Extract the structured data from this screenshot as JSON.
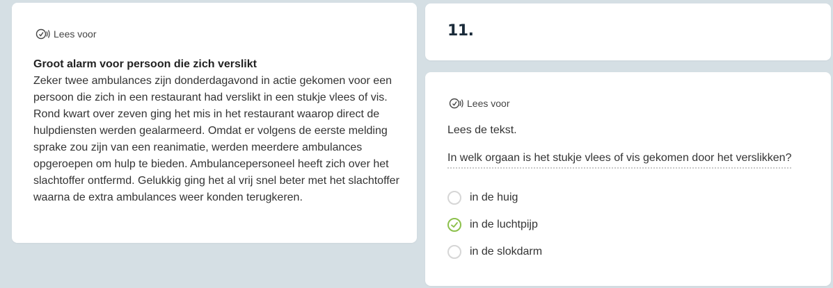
{
  "read_aloud_label": "Lees voor",
  "article": {
    "title": "Groot alarm voor persoon die zich verslikt",
    "body": "Zeker twee ambulances zijn donderdagavond in actie gekomen voor een persoon die zich in een restaurant had verslikt in een stukje vlees of vis. Rond kwart over zeven ging het mis in het restaurant waarop direct de hulpdiensten werden gealarmeerd. Omdat er volgens de eerste melding sprake zou zijn van een reanimatie, werden meerdere ambulances opgeroepen om hulp te bieden. Ambulancepersoneel heeft zich over het slachtoffer ontfermd. Gelukkig ging het al vrij snel beter met het slachtoffer waarna de extra ambulances weer konden terugkeren."
  },
  "question_number": "11.",
  "instruction": "Lees de tekst.",
  "question": "In welk orgaan is het stukje vlees of vis gekomen door het verslikken?",
  "options": [
    {
      "label": "in de huig",
      "selected": false
    },
    {
      "label": "in de luchtpijp",
      "selected": true
    },
    {
      "label": "in de slokdarm",
      "selected": false
    }
  ],
  "colors": {
    "background": "#d5dfe4",
    "card": "#ffffff",
    "selected_green": "#8cc04b",
    "radio_border": "#d6d6d6"
  },
  "icons": {
    "read_aloud": "speaker-icon",
    "selected": "checkmark-icon"
  }
}
